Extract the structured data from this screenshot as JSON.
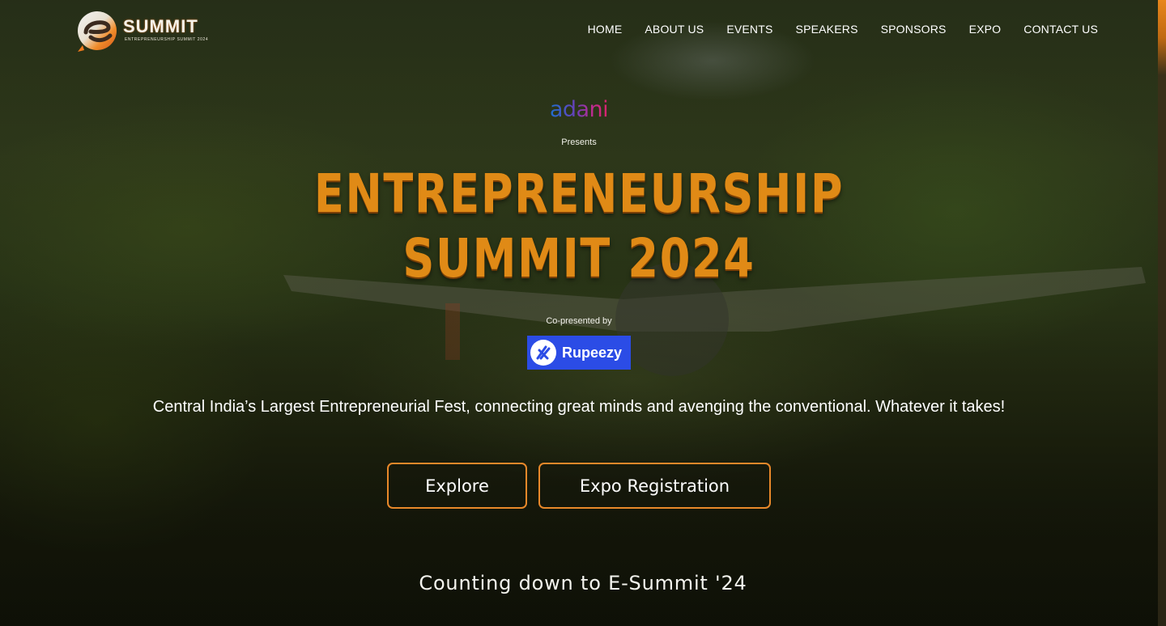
{
  "header": {
    "logo_word": "SUMMIT",
    "logo_tagline": "ENTREPRENEURSHIP SUMMIT 2024",
    "nav": [
      "HOME",
      "ABOUT US",
      "EVENTS",
      "SPEAKERS",
      "SPONSORS",
      "EXPO",
      "CONTACT US"
    ]
  },
  "hero": {
    "sponsor_top": "adani",
    "presents": "Presents",
    "headline_line1": "ENTREPRENEURSHIP",
    "headline_line2": "SUMMIT 2024",
    "copresented": "Co-presented by",
    "co_sponsor": "Rupeezy",
    "tagline": "Central India’s Largest Entrepreneurial Fest, connecting great minds and avenging the conventional. Whatever it takes!",
    "buttons": {
      "explore": "Explore",
      "expo_registration": "Expo Registration"
    },
    "countdown_heading": "Counting down to E-Summit '24"
  },
  "colors": {
    "accent": "#e8882a",
    "headline": "#e08a16",
    "rupeezy_blue": "#2b4ce6"
  }
}
